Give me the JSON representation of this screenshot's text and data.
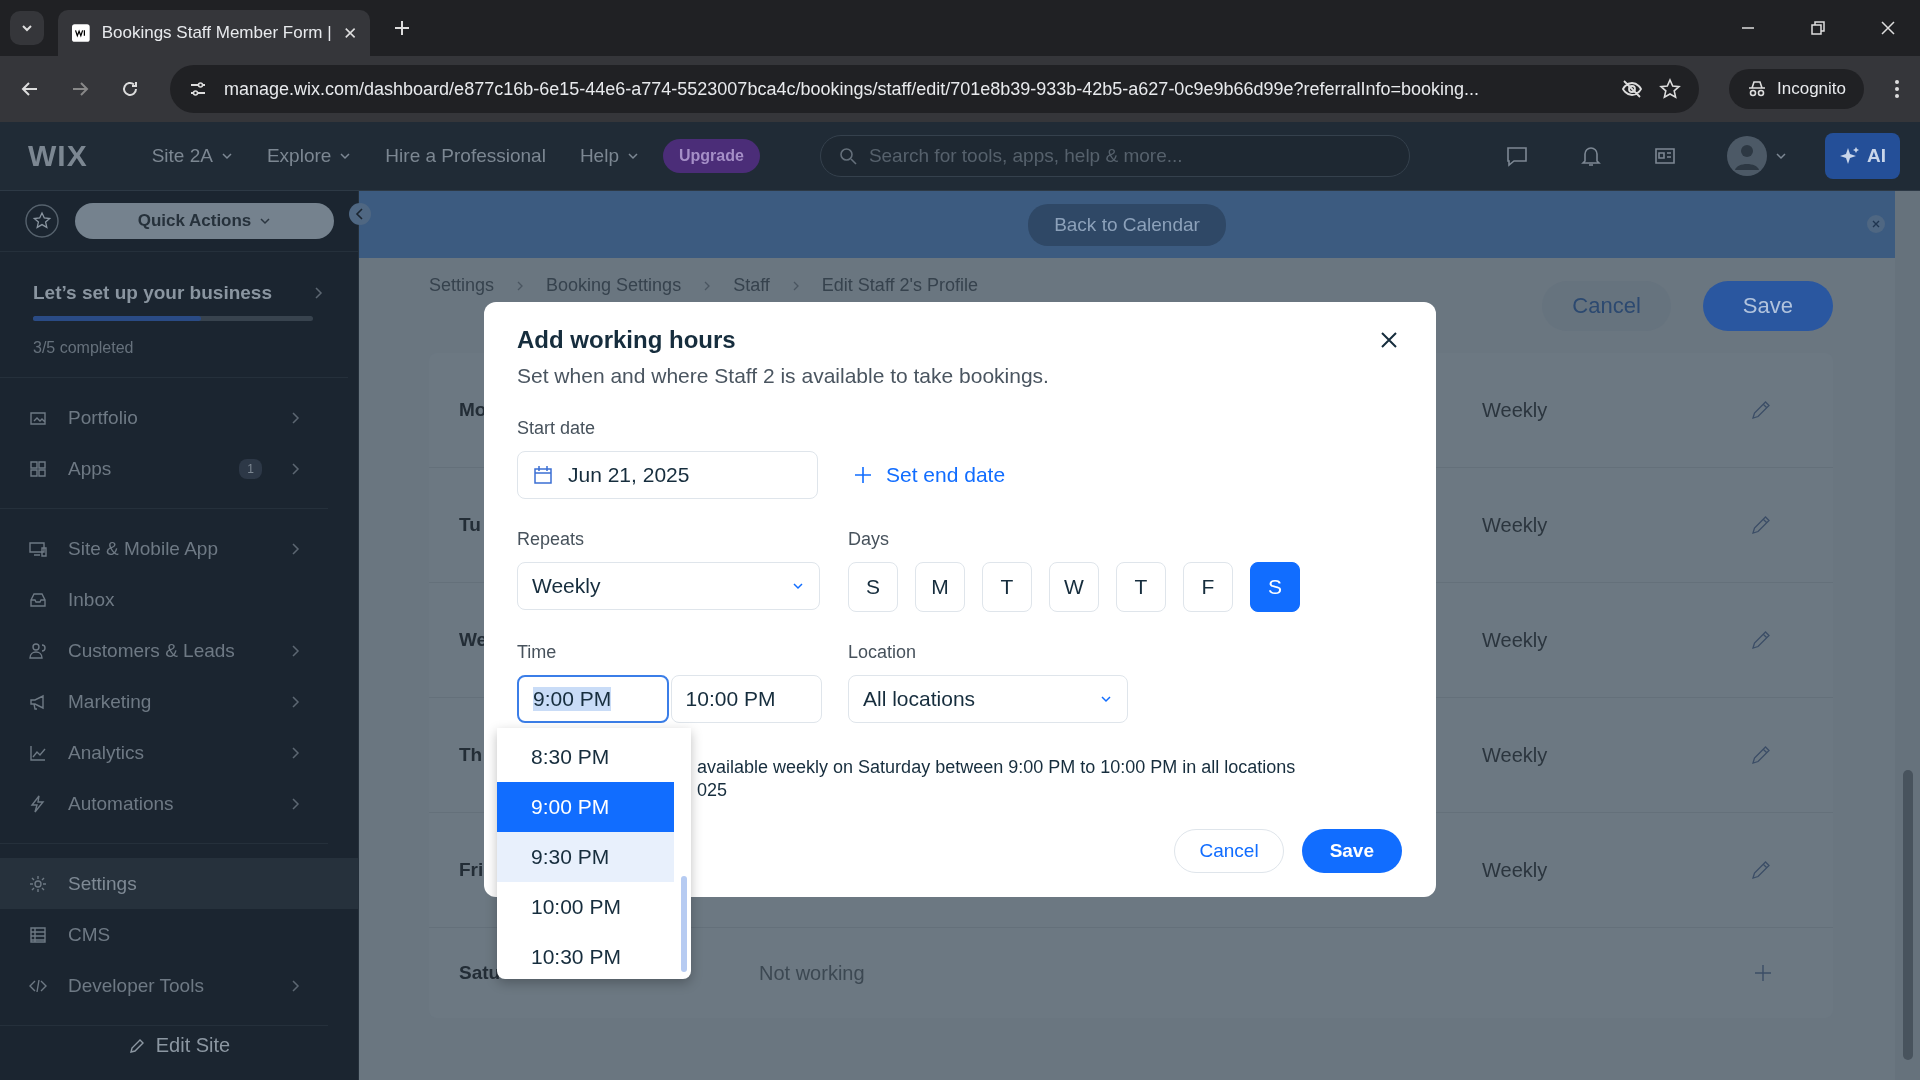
{
  "browser": {
    "tab_title": "Bookings Staff Member Form |",
    "url": "manage.wix.com/dashboard/e877c16b-6e15-44e6-a774-5523007bca4c/bookings/staff/edit/701e8b39-933b-42b5-a627-0c9e9b66d99e?referralInfo=booking...",
    "profile": "Incognito"
  },
  "topbar": {
    "logo": "WIX",
    "site": "Site 2A",
    "nav": [
      {
        "label": "Explore",
        "has_menu": true
      },
      {
        "label": "Hire a Professional",
        "has_menu": false
      },
      {
        "label": "Help",
        "has_menu": true
      }
    ],
    "upgrade": "Upgrade",
    "search_placeholder": "Search for tools, apps, help & more...",
    "ai": "AI"
  },
  "sidebar": {
    "quick_actions": "Quick Actions",
    "setup": {
      "title": "Let’s set up your business",
      "level": 0.6,
      "progress": "3/5 completed"
    },
    "groups": [
      [
        {
          "label": "Portfolio",
          "selected": false,
          "has_children": true
        },
        {
          "label": "Apps",
          "selected": false,
          "has_children": true,
          "badge": "1"
        }
      ],
      [
        {
          "label": "Site & Mobile App",
          "selected": false,
          "has_children": true
        },
        {
          "label": "Inbox",
          "selected": false,
          "has_children": false
        },
        {
          "label": "Customers & Leads",
          "selected": false,
          "has_children": true
        },
        {
          "label": "Marketing",
          "selected": false,
          "has_children": true
        },
        {
          "label": "Analytics",
          "selected": false,
          "has_children": true
        },
        {
          "label": "Automations",
          "selected": false,
          "has_children": true
        }
      ],
      [
        {
          "label": "Settings",
          "selected": true,
          "has_children": false
        },
        {
          "label": "CMS",
          "selected": false,
          "has_children": false
        },
        {
          "label": "Developer Tools",
          "selected": false,
          "has_children": true
        }
      ]
    ],
    "edit_site": "Edit Site"
  },
  "banner": {
    "button": "Back to Calendar"
  },
  "page": {
    "breadcrumbs": [
      "Settings",
      "Booking Settings",
      "Staff",
      "Edit Staff 2's Profile"
    ],
    "cancel": "Cancel",
    "save": "Save",
    "rows": [
      {
        "kind": "working",
        "day": "Mo",
        "repeat": "Weekly"
      },
      {
        "kind": "working",
        "day": "Tu",
        "repeat": "Weekly"
      },
      {
        "kind": "working",
        "day": "We",
        "repeat": "Weekly"
      },
      {
        "kind": "working",
        "day": "Th",
        "repeat": "Weekly"
      },
      {
        "kind": "working",
        "day": "Fri",
        "repeat": "Weekly"
      },
      {
        "kind": "off",
        "day": "Satu",
        "repeat": "Not working"
      }
    ]
  },
  "dialog": {
    "title": "Add working hours",
    "subtitle": "Set when and where Staff 2 is available to take bookings.",
    "start_date_label": "Start date",
    "start_date": "Jun 21, 2025",
    "set_end_date": "Set end date",
    "repeats_label": "Repeats",
    "repeats": "Weekly",
    "days_label": "Days",
    "days": [
      {
        "label": "S",
        "selected": false
      },
      {
        "label": "M",
        "selected": false
      },
      {
        "label": "T",
        "selected": false
      },
      {
        "label": "W",
        "selected": false
      },
      {
        "label": "T",
        "selected": false
      },
      {
        "label": "F",
        "selected": false
      },
      {
        "label": "S",
        "selected": true
      }
    ],
    "time_label": "Time",
    "start_time": "9:00 PM",
    "end_time": "10:00 PM",
    "location_label": "Location",
    "location": "All locations",
    "time_options": [
      {
        "label": "8:30 PM",
        "selected": false,
        "hovered": false
      },
      {
        "label": "9:00 PM",
        "selected": true,
        "hovered": false
      },
      {
        "label": "9:30 PM",
        "selected": false,
        "hovered": true
      },
      {
        "label": "10:00 PM",
        "selected": false,
        "hovered": false
      },
      {
        "label": "10:30 PM",
        "selected": false,
        "hovered": false
      }
    ],
    "summary": [
      "available weekly on Saturday between 9:00 PM to 10:00 PM in all locations",
      "025"
    ],
    "cancel": "Cancel",
    "save": "Save"
  }
}
